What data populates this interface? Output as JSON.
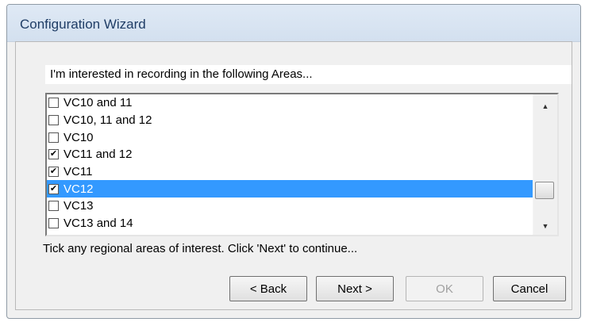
{
  "window": {
    "title": "Configuration Wizard"
  },
  "prompt": {
    "text": "I'm interested in recording in the following Areas..."
  },
  "areas": [
    {
      "label": "VC10 and 11",
      "checked": false,
      "selected": false
    },
    {
      "label": "VC10, 11 and 12",
      "checked": false,
      "selected": false
    },
    {
      "label": "VC10",
      "checked": false,
      "selected": false
    },
    {
      "label": "VC11 and 12",
      "checked": true,
      "selected": false
    },
    {
      "label": "VC11",
      "checked": true,
      "selected": false
    },
    {
      "label": "VC12",
      "checked": true,
      "selected": true
    },
    {
      "label": "VC13",
      "checked": false,
      "selected": false
    },
    {
      "label": "VC13 and 14",
      "checked": false,
      "selected": false
    }
  ],
  "hint": {
    "text": "Tick any regional areas of interest.  Click 'Next' to continue..."
  },
  "buttons": {
    "back": "< Back",
    "next": "Next >",
    "ok": "OK",
    "cancel": "Cancel"
  },
  "icons": {
    "check": "✔",
    "up_arrow": "▲",
    "down_arrow": "▼"
  },
  "colors": {
    "selection": "#3399ff",
    "title_text": "#1f3d66"
  }
}
